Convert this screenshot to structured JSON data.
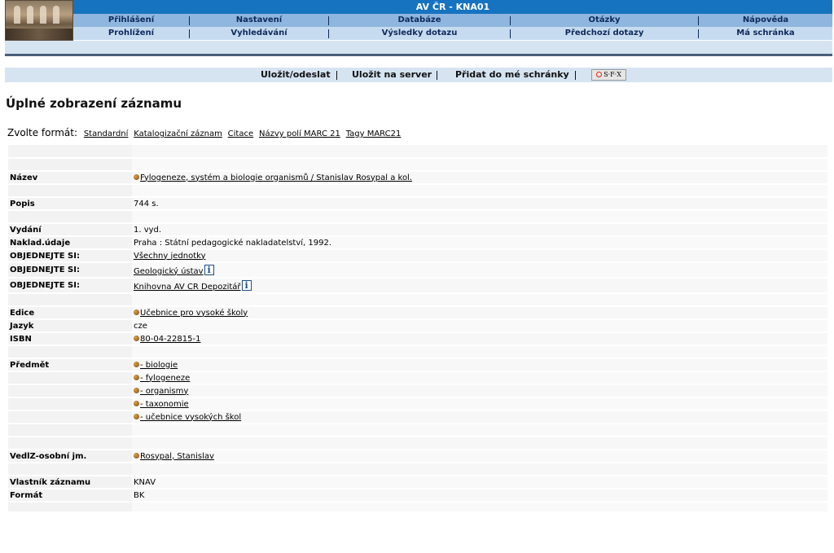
{
  "header": {
    "title": "AV ČR - KNA01",
    "menu_row1": [
      "Přihlášení",
      "Nastavení",
      "Databáze",
      "Otázky",
      "Nápověda"
    ],
    "menu_row2": [
      "Prohlížení",
      "Vyhledávání",
      "Výsledky dotazu",
      "Předchozí dotazy",
      "Má schránka"
    ]
  },
  "actions": [
    "Uložit/odeslat",
    "Uložit na server",
    "Přidat do mé schránky"
  ],
  "sfx_label": "S·F·X",
  "page_title": "Úplné zobrazení záznamu",
  "formats": {
    "label": "Zvolte formát:",
    "options": [
      "Standardní",
      "Katalogizační záznam",
      "Citace",
      "Názvy polí MARC 21",
      "Tagy MARC21"
    ]
  },
  "record": {
    "nazev_label": "Název",
    "nazev_value": "Fylogeneze, systém a biologie organismů / Stanislav Rosypal a kol.",
    "popis_label": "Popis",
    "popis_value": "744 s.",
    "vydani_label": "Vydání",
    "vydani_value": "1. vyd.",
    "naklad_label": "Naklad.údaje",
    "naklad_value": "Praha : Státní pedagogické nakladatelství, 1992.",
    "order_label": "OBJEDNEJTE SI:",
    "order1_value": "Všechny jednotky",
    "order2_value": "Geologický ústav",
    "order3_value": "Knihovna AV CR Depozitář",
    "edice_label": "Edice",
    "edice_value": "Učebnice pro vysoké školy",
    "jazyk_label": "Jazyk",
    "jazyk_value": "cze",
    "isbn_label": "ISBN",
    "isbn_value": "80-04-22815-1",
    "predmet_label": "Předmět",
    "subjects": [
      "- biologie",
      "- fylogeneze",
      "- organismy",
      "- taxonomie",
      "- učebnice vysokých škol"
    ],
    "vedlz_label": "VedlZ-osobní jm.",
    "vedlz_value": "Rosypal, Stanislav",
    "vlastnik_label": "Vlastník záznamu",
    "vlastnik_value": "KNAV",
    "format_label": "Formát",
    "format_value": "BK"
  }
}
